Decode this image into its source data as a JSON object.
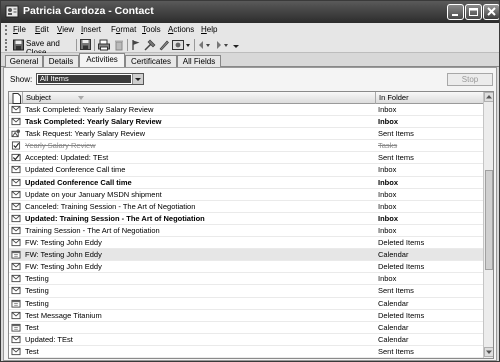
{
  "window": {
    "title": "Patricia Cardoza - Contact"
  },
  "menubar": {
    "items": [
      {
        "label": "File",
        "key": "F",
        "rest": "ile"
      },
      {
        "label": "Edit",
        "key": "E",
        "rest": "dit"
      },
      {
        "label": "View",
        "key": "V",
        "rest": "iew"
      },
      {
        "label": "Insert",
        "key": "I",
        "rest": "nsert"
      },
      {
        "label": "Format",
        "key": "o",
        "pre": "F",
        "rest": "rmat"
      },
      {
        "label": "Tools",
        "key": "T",
        "rest": "ools"
      },
      {
        "label": "Actions",
        "key": "A",
        "rest": "ctions"
      },
      {
        "label": "Help",
        "key": "H",
        "rest": "elp"
      }
    ]
  },
  "toolbar": {
    "save_close_label": "Save and Close",
    "icons": [
      "save-icon",
      "print-icon",
      "delete-icon",
      "flag-icon",
      "categorize-icon",
      "options-icon",
      "previous-icon",
      "next-icon",
      "toolbar-options-icon"
    ]
  },
  "tabs": [
    {
      "label": "General",
      "active": false
    },
    {
      "label": "Details",
      "active": false
    },
    {
      "label": "Activities",
      "active": true
    },
    {
      "label": "Certificates",
      "active": false
    },
    {
      "label": "All Fields",
      "active": false
    }
  ],
  "filter": {
    "show_label": "Show:",
    "selected": "All Items",
    "stop_label": "Stop"
  },
  "grid": {
    "columns": {
      "subject": "Subject",
      "folder": "In Folder"
    },
    "rows": [
      {
        "subject": "Task Completed: Yearly Salary Review",
        "folder": "Inbox",
        "icon": "mail-icon",
        "style": "normal"
      },
      {
        "subject": "Task Completed: Yearly Salary Review",
        "folder": "Inbox",
        "icon": "mail-icon",
        "style": "bold"
      },
      {
        "subject": "Task Request: Yearly Salary Review",
        "folder": "Sent Items",
        "icon": "task-request-icon",
        "style": "normal"
      },
      {
        "subject": "Yearly Salary Review",
        "folder": "Tasks",
        "icon": "task-icon",
        "style": "strike"
      },
      {
        "subject": "Accepted: Updated: TEst",
        "folder": "Sent Items",
        "icon": "accepted-icon",
        "style": "normal"
      },
      {
        "subject": "Updated Conference Call time",
        "folder": "Inbox",
        "icon": "mail-icon",
        "style": "normal"
      },
      {
        "subject": "Updated Conference Call time",
        "folder": "Inbox",
        "icon": "mail-icon",
        "style": "bold"
      },
      {
        "subject": "Update on your January MSDN shipment",
        "folder": "Inbox",
        "icon": "mail-icon",
        "style": "normal"
      },
      {
        "subject": "Canceled: Training Session - The Art of Negotiation",
        "folder": "Inbox",
        "icon": "mail-icon",
        "style": "normal"
      },
      {
        "subject": "Updated: Training Session - The Art of Negotiation",
        "folder": "Inbox",
        "icon": "mail-icon",
        "style": "bold"
      },
      {
        "subject": "Training Session - The Art of Negotiation",
        "folder": "Inbox",
        "icon": "mail-icon",
        "style": "normal"
      },
      {
        "subject": "FW: Testing John Eddy",
        "folder": "Deleted Items",
        "icon": "mail-icon",
        "style": "normal"
      },
      {
        "subject": "FW: Testing John Eddy",
        "folder": "Calendar",
        "icon": "calendar-icon",
        "style": "selected"
      },
      {
        "subject": "FW: Testing John Eddy",
        "folder": "Deleted Items",
        "icon": "mail-icon",
        "style": "normal"
      },
      {
        "subject": "Testing",
        "folder": "Inbox",
        "icon": "mail-icon",
        "style": "normal"
      },
      {
        "subject": "Testing",
        "folder": "Sent Items",
        "icon": "mail-icon",
        "style": "normal"
      },
      {
        "subject": "Testing",
        "folder": "Calendar",
        "icon": "calendar-icon",
        "style": "normal"
      },
      {
        "subject": "Test Message Titanium",
        "folder": "Deleted Items",
        "icon": "mail-icon",
        "style": "normal"
      },
      {
        "subject": "Test",
        "folder": "Calendar",
        "icon": "calendar-icon",
        "style": "normal"
      },
      {
        "subject": "Updated: TEst",
        "folder": "Calendar",
        "icon": "mail-icon",
        "style": "normal"
      },
      {
        "subject": "Test",
        "folder": "Sent Items",
        "icon": "mail-icon",
        "style": "normal"
      }
    ]
  }
}
